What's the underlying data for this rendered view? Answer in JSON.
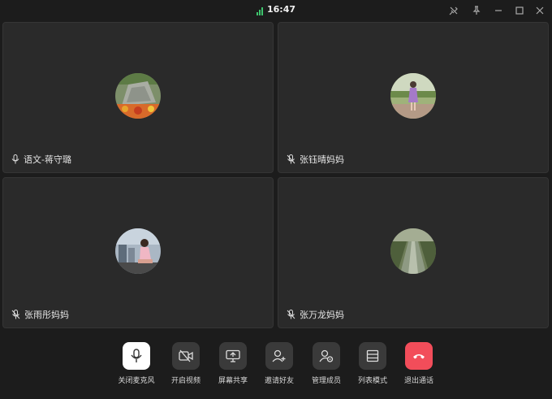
{
  "status": {
    "time": "16:47",
    "signal_color": "#3ec46d"
  },
  "window_controls": [
    "unpin-icon",
    "pin-icon",
    "minimize-icon",
    "maximize-icon",
    "close-icon"
  ],
  "participants": [
    {
      "name": "语文-蒋守璐",
      "mic": "on"
    },
    {
      "name": "张钰晴妈妈",
      "mic": "muted"
    },
    {
      "name": "张雨彤妈妈",
      "mic": "muted"
    },
    {
      "name": "张万龙妈妈",
      "mic": "muted"
    }
  ],
  "toolbar": {
    "mute_label": "关闭麦克风",
    "video_label": "开启视频",
    "share_label": "屏幕共享",
    "invite_label": "邀请好友",
    "manage_label": "管理成员",
    "layout_label": "列表模式",
    "leave_label": "退出通话"
  },
  "colors": {
    "background": "#1c1c1c",
    "tile": "#2a2a2a",
    "leave": "#f24d5a"
  }
}
